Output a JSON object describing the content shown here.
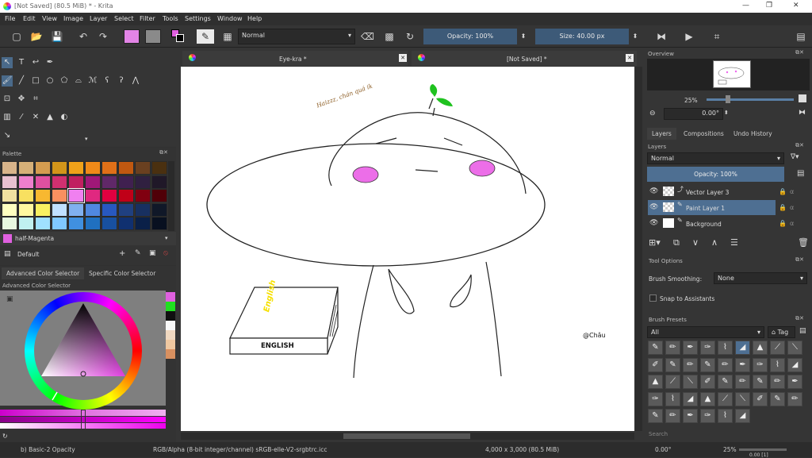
{
  "window": {
    "title": "[Not Saved]  (80.5 MiB)  * - Krita"
  },
  "menu": [
    "File",
    "Edit",
    "View",
    "Image",
    "Layer",
    "Select",
    "Filter",
    "Tools",
    "Settings",
    "Window",
    "Help"
  ],
  "toolbar": {
    "blend_mode": "Normal",
    "opacity": "Opacity: 100%",
    "size": "Size: 40.00 px"
  },
  "doc_tabs": [
    {
      "label": "Eye-kra *"
    },
    {
      "label": "[Not Saved]  *"
    }
  ],
  "palette": {
    "title": "Palette",
    "current_color": "half-Magenta",
    "preset": "Default",
    "colors": [
      "#d8b48a",
      "#d6b078",
      "#d49c50",
      "#d2951a",
      "#f0a21a",
      "#f08a18",
      "#e07018",
      "#c05810",
      "#6a4020",
      "#4a3010",
      "#e8c0d0",
      "#ee7fcc",
      "#e050a0",
      "#d03070",
      "#c02060",
      "#a01878",
      "#602868",
      "#402050",
      "#302040",
      "#201828",
      "#f0e0a0",
      "#f8e060",
      "#f8b830",
      "#f89060",
      "#f080f0",
      "#e02880",
      "#e00040",
      "#c00018",
      "#800010",
      "#500008",
      "#ffffc0",
      "#fff8a0",
      "#f8f060",
      "#c0e0ff",
      "#80b0f0",
      "#5088e0",
      "#2858c0",
      "#204080",
      "#183060",
      "#101828",
      "#e8f8e0",
      "#c0f0f0",
      "#a0e0ff",
      "#80c8ff",
      "#4090e0",
      "#2070c0",
      "#1850a0",
      "#103070",
      "#0a2048",
      "#081020"
    ]
  },
  "color_selector": {
    "tab_advanced": "Advanced Color Selector",
    "tab_specific": "Specific Color Selector",
    "title": "Advanced Color Selector",
    "side_colors": [
      "#e060e0",
      "#20e020",
      "#101010",
      "#f8f8f8",
      "#f0d8c0",
      "#f0c8a0",
      "#d89060"
    ]
  },
  "overview": {
    "title": "Overview",
    "zoom": "25%",
    "rotation": "0.00°"
  },
  "layers_panel": {
    "tabs": [
      "Layers",
      "Compositions",
      "Undo History"
    ],
    "title": "Layers",
    "blend": "Normal",
    "opacity": "Opacity:  100%",
    "layers": [
      {
        "name": "Vector Layer 3"
      },
      {
        "name": "Paint Layer 1"
      },
      {
        "name": "Background"
      }
    ]
  },
  "tool_options": {
    "title": "Tool Options",
    "smoothing_label": "Brush Smoothing:",
    "smoothing_value": "None",
    "snap": "Snap to Assistants"
  },
  "brush_presets": {
    "title": "Brush Presets",
    "filter": "All",
    "tag": "Tag",
    "search": "Search",
    "count": 42
  },
  "drawing": {
    "caption": "Haizzz, chán quá ik",
    "book_spine": "English",
    "book_label": "ENGLISH",
    "signature": "@Châu"
  },
  "status": {
    "brush": "b) Basic-2 Opacity",
    "color_model": "RGB/Alpha (8-bit integer/channel)  sRGB-elle-V2-srgbtrc.icc",
    "dimensions": "4,000 x 3,000 (80.5 MiB)",
    "rotation": "0.00°",
    "zoom": "25%",
    "extra": "0.00 [1]"
  }
}
